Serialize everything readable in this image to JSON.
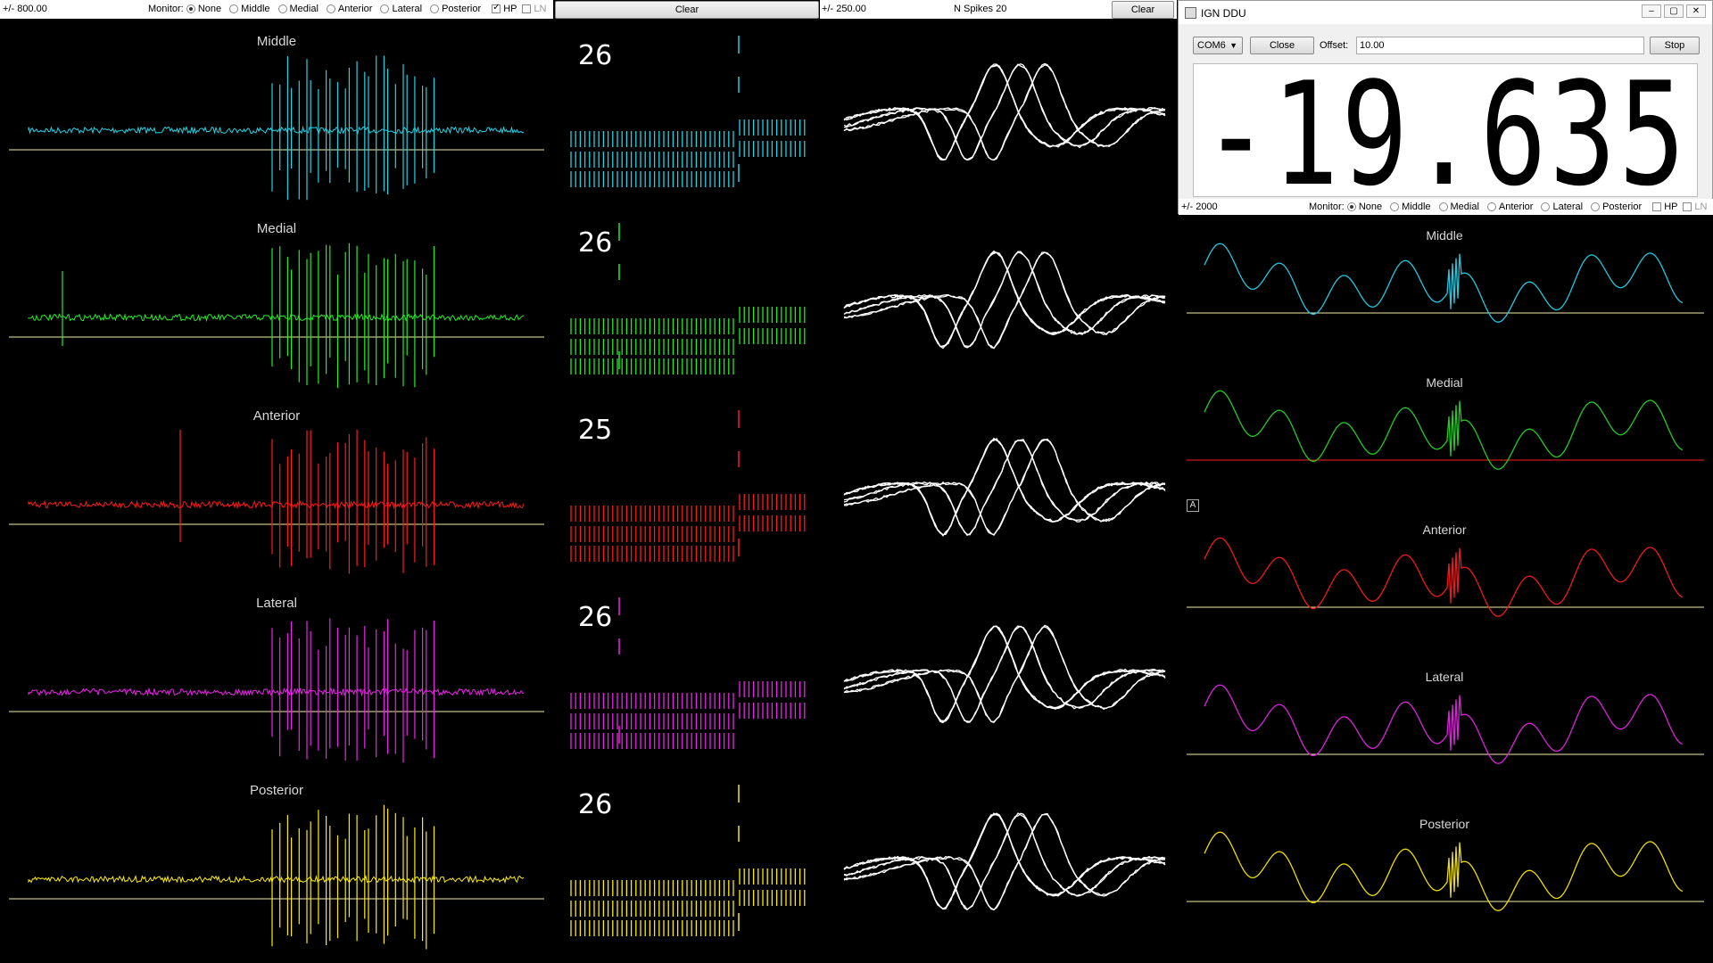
{
  "top_left_toolbar": {
    "range_label": "+/- 800.00",
    "monitor_label": "Monitor:",
    "options": [
      "None",
      "Middle",
      "Medial",
      "Anterior",
      "Lateral",
      "Posterior"
    ],
    "selected": "None",
    "hp_label": "HP",
    "hp_checked": true,
    "ln_label": "LN",
    "ln_checked": false,
    "clear_label": "Clear"
  },
  "top_mid_toolbar": {
    "range_label": "+/- 250.00",
    "nspikes_label": "N Spikes 20",
    "clear_label": "Clear"
  },
  "ddu_window": {
    "title": "IGN DDU",
    "port": "COM6",
    "close_label": "Close",
    "offset_label": "Offset:",
    "offset_value": "10.00",
    "stop_label": "Stop",
    "reading": "-19.635",
    "range_label": "+/- 2000",
    "monitor_label": "Monitor:",
    "options": [
      "None",
      "Middle",
      "Medial",
      "Anterior",
      "Lateral",
      "Posterior"
    ],
    "selected": "None",
    "hp_label": "HP",
    "hp_checked": false,
    "ln_label": "LN",
    "ln_checked": false
  },
  "channels": [
    {
      "name": "Middle",
      "color": "#22d3e6",
      "spike_count": "26"
    },
    {
      "name": "Medial",
      "color": "#22ee22",
      "spike_count": "26"
    },
    {
      "name": "Anterior",
      "color": "#ff1a1a",
      "spike_count": "25"
    },
    {
      "name": "Lateral",
      "color": "#ee22ee",
      "spike_count": "26"
    },
    {
      "name": "Posterior",
      "color": "#ffee00",
      "spike_count": "26"
    }
  ],
  "lfp_channels": [
    {
      "name": "Middle",
      "color": "#22c8e0"
    },
    {
      "name": "Medial",
      "color": "#22cc22"
    },
    {
      "name": "Anterior",
      "color": "#ee1a1a"
    },
    {
      "name": "Lateral",
      "color": "#dd22dd"
    },
    {
      "name": "Posterior",
      "color": "#eedd00"
    }
  ],
  "overlay_badge": "A",
  "colors": {
    "baseline": "#f5f0a8",
    "medial_red_line": "#ff2020",
    "waveform": "#ffffff"
  }
}
